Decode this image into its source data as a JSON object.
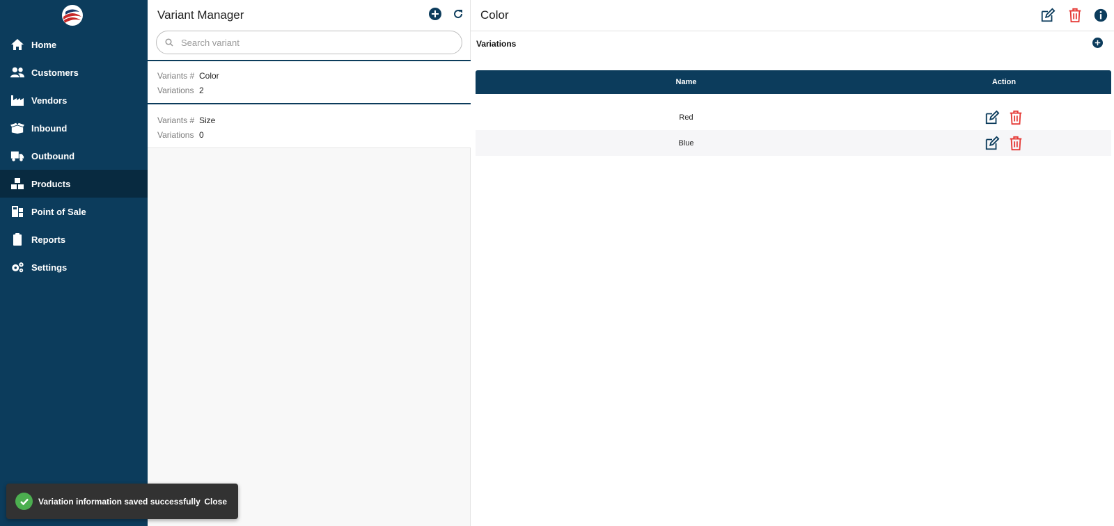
{
  "colors": {
    "sidebar": "#0c3c5c",
    "sidebar_active": "#082a40",
    "accent": "#0c3c5c",
    "danger": "#e53935",
    "toast_bg": "#323232",
    "success": "#4caf50"
  },
  "sidebar": {
    "logo": "eagle-flag-logo",
    "items": [
      {
        "label": "Home",
        "icon": "home-icon"
      },
      {
        "label": "Customers",
        "icon": "users-icon"
      },
      {
        "label": "Vendors",
        "icon": "factory-icon"
      },
      {
        "label": "Inbound",
        "icon": "box-open-icon"
      },
      {
        "label": "Outbound",
        "icon": "truck-icon"
      },
      {
        "label": "Products",
        "icon": "boxes-icon",
        "active": true
      },
      {
        "label": "Point of Sale",
        "icon": "cash-register-icon"
      },
      {
        "label": "Reports",
        "icon": "clipboard-icon"
      },
      {
        "label": "Settings",
        "icon": "cogs-icon"
      }
    ]
  },
  "variant_manager": {
    "title": "Variant Manager",
    "search_placeholder": "Search variant",
    "label_variant": "Variants #",
    "label_variations": "Variations",
    "variants": [
      {
        "name": "Color",
        "variations": "2",
        "selected": true
      },
      {
        "name": "Size",
        "variations": "0",
        "selected": false
      }
    ]
  },
  "detail": {
    "title": "Color",
    "section_title": "Variations",
    "columns": {
      "name": "Name",
      "action": "Action"
    },
    "rows": [
      {
        "name": "Red"
      },
      {
        "name": "Blue"
      }
    ]
  },
  "toast": {
    "message": "Variation information saved successfully",
    "close_label": "Close"
  }
}
